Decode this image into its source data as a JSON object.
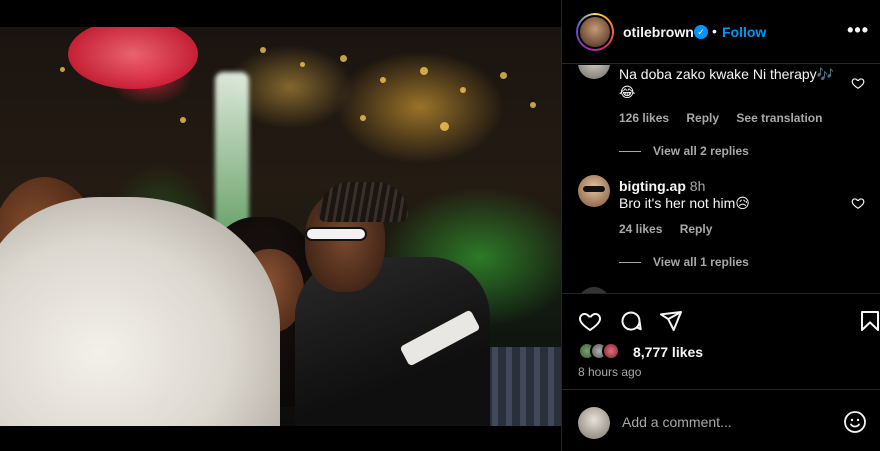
{
  "post": {
    "author": {
      "username": "otilebrown",
      "verified_icon": "verified-badge-icon",
      "follow_label": "Follow",
      "separator": "•"
    },
    "more_icon": "more-options-icon",
    "more_label": "•••"
  },
  "comments": [
    {
      "text": "Na doba zako kwake Ni therapy🎶😂",
      "likes": "126 likes",
      "reply_label": "Reply",
      "translate_label": "See translation",
      "view_replies": "View all 2 replies"
    },
    {
      "username": "bigting.ap",
      "time": "8h",
      "text": "Bro it's her not him😥",
      "likes": "24 likes",
      "reply_label": "Reply",
      "view_replies": "View all 1 replies"
    }
  ],
  "actions": {
    "like_icon": "heart-icon",
    "comment_icon": "comment-icon",
    "share_icon": "share-icon",
    "save_icon": "bookmark-icon",
    "likes_count": "8,777 likes",
    "time_ago": "8 hours ago"
  },
  "add_comment": {
    "placeholder": "Add a comment...",
    "emoji_icon": "emoji-icon"
  },
  "colors": {
    "background": "#000000",
    "text": "#f5f5f5",
    "secondary_text": "#a8a8a8",
    "link_blue": "#0095f6",
    "divider": "#262626"
  }
}
